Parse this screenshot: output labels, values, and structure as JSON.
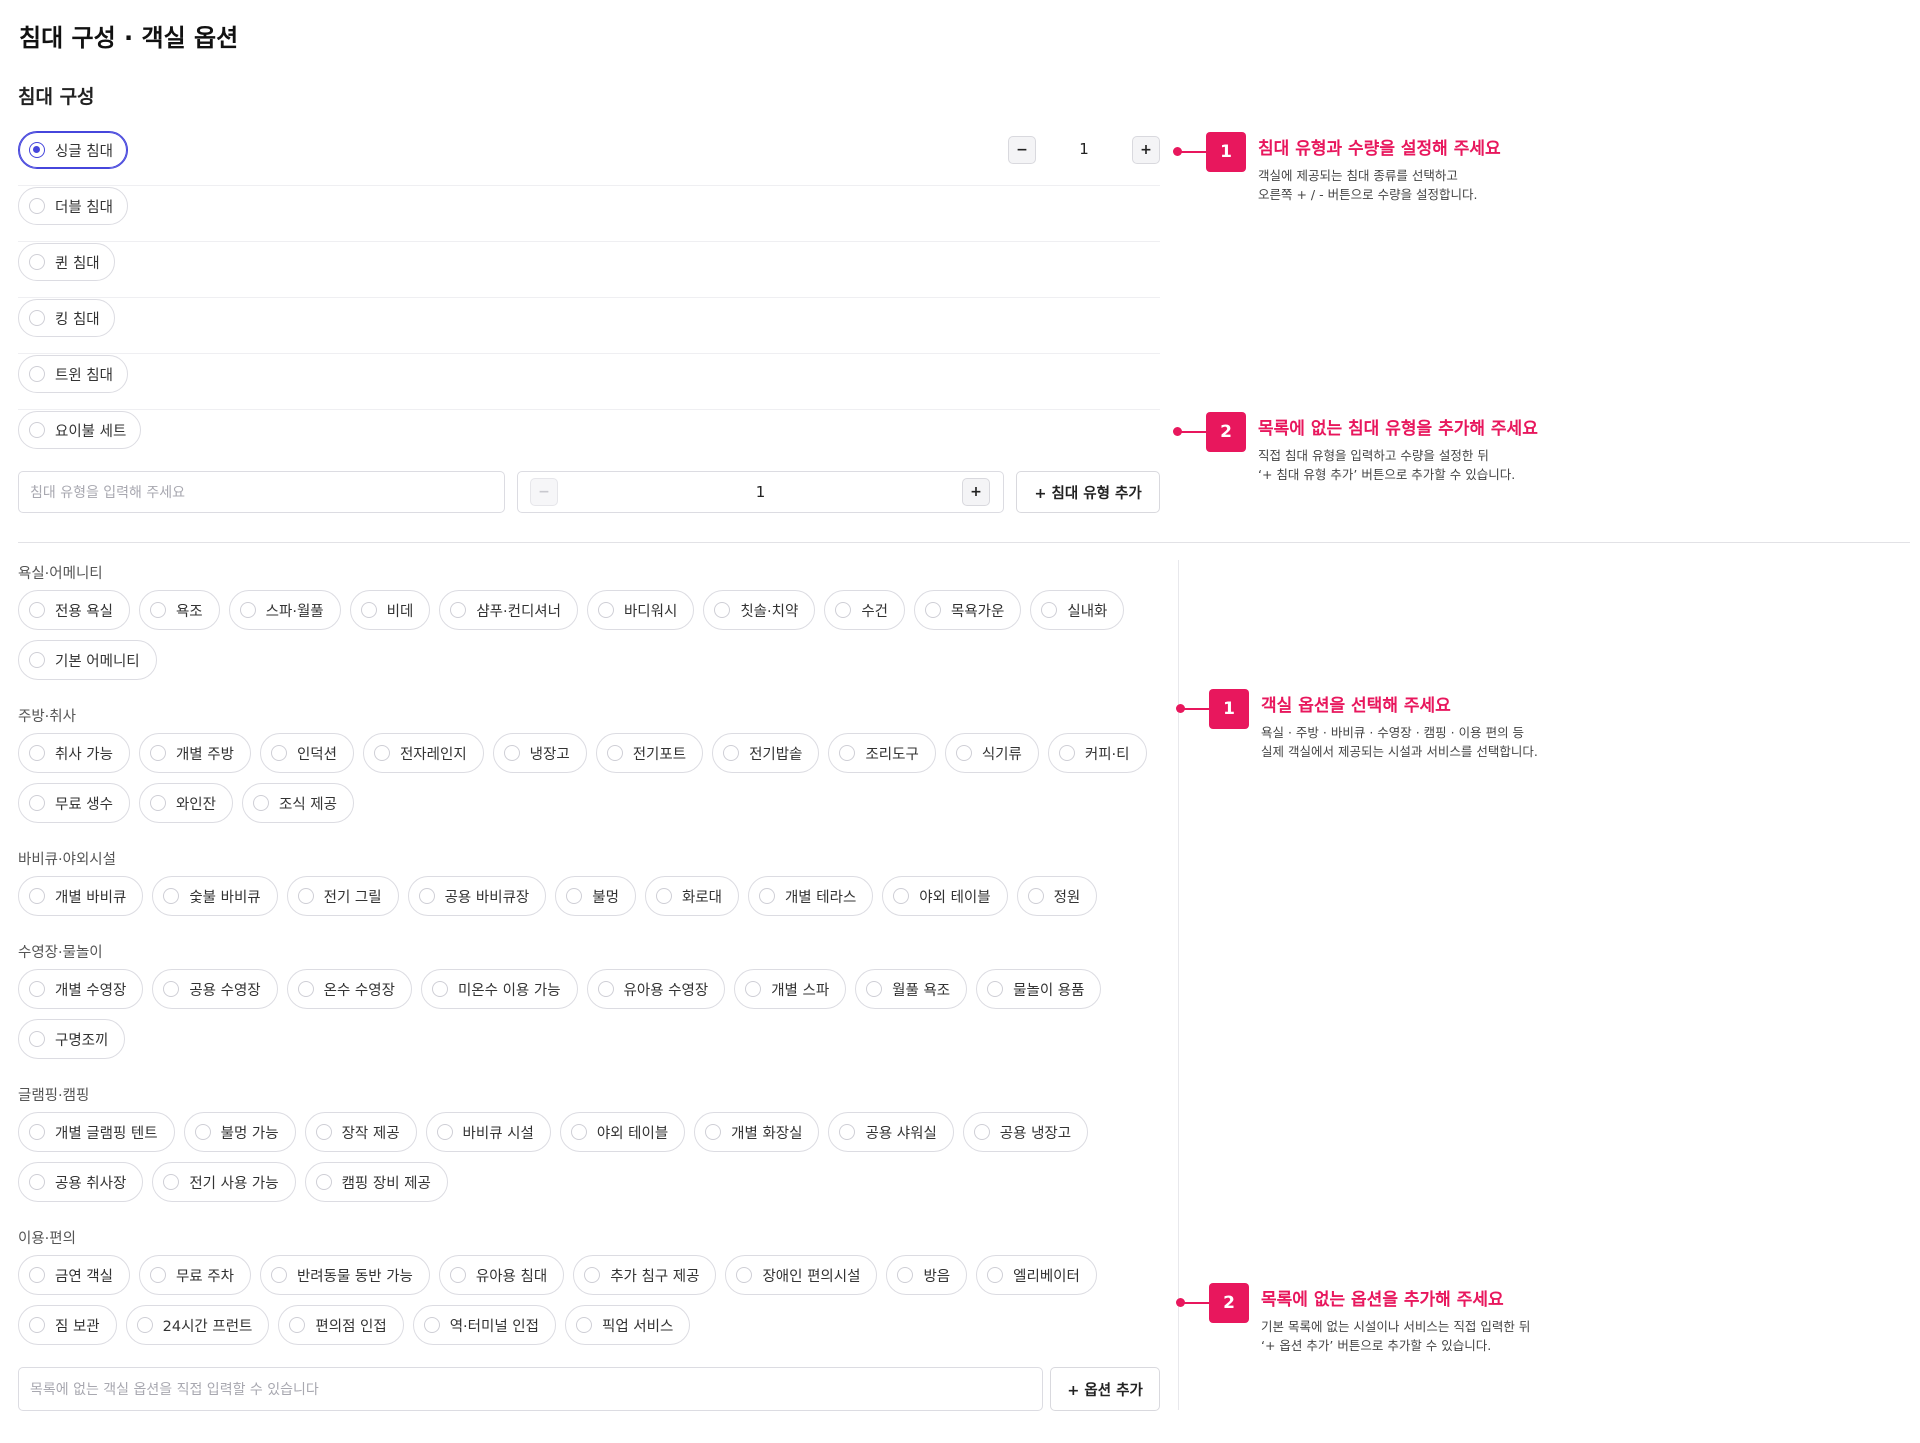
{
  "page_title": "침대 구성 · 객실 옵션",
  "bed_section": {
    "title": "침대 구성",
    "beds": [
      {
        "label": "싱글 침대",
        "selected": true
      },
      {
        "label": "더블 침대",
        "selected": false
      },
      {
        "label": "퀸 침대",
        "selected": false
      },
      {
        "label": "킹 침대",
        "selected": false
      },
      {
        "label": "트윈 침대",
        "selected": false
      },
      {
        "label": "요이불 세트",
        "selected": false
      }
    ],
    "stepper": {
      "minus": "−",
      "value": "1",
      "plus": "+"
    },
    "custom": {
      "placeholder": "침대 유형을 입력해 주세요",
      "stepper_minus": "−",
      "stepper_value": "1",
      "stepper_plus": "+",
      "add_button": "+ 침대 유형 추가"
    }
  },
  "option_groups": [
    {
      "label": "욕실·어메니티",
      "options": [
        "전용 욕실",
        "욕조",
        "스파·월풀",
        "비데",
        "샴푸·컨디셔너",
        "바디워시",
        "칫솔·치약",
        "수건",
        "목욕가운",
        "실내화",
        "기본 어메니티"
      ]
    },
    {
      "label": "주방·취사",
      "options": [
        "취사 가능",
        "개별 주방",
        "인덕션",
        "전자레인지",
        "냉장고",
        "전기포트",
        "전기밥솥",
        "조리도구",
        "식기류",
        "커피·티",
        "무료 생수",
        "와인잔",
        "조식 제공"
      ]
    },
    {
      "label": "바비큐·야외시설",
      "options": [
        "개별 바비큐",
        "숯불 바비큐",
        "전기 그릴",
        "공용 바비큐장",
        "불멍",
        "화로대",
        "개별 테라스",
        "야외 테이블",
        "정원"
      ]
    },
    {
      "label": "수영장·물놀이",
      "options": [
        "개별 수영장",
        "공용 수영장",
        "온수 수영장",
        "미온수 이용 가능",
        "유아용 수영장",
        "개별 스파",
        "월풀 욕조",
        "물놀이 용품",
        "구명조끼"
      ]
    },
    {
      "label": "글램핑·캠핑",
      "options": [
        "개별 글램핑 텐트",
        "불멍 가능",
        "장작 제공",
        "바비큐 시설",
        "야외 테이블",
        "개별 화장실",
        "공용 샤워실",
        "공용 냉장고",
        "공용 취사장",
        "전기 사용 가능",
        "캠핑 장비 제공"
      ]
    },
    {
      "label": "이용·편의",
      "options": [
        "금연 객실",
        "무료 주차",
        "반려동물 동반 가능",
        "유아용 침대",
        "추가 침구 제공",
        "장애인 편의시설",
        "방음",
        "엘리베이터",
        "짐 보관",
        "24시간 프런트",
        "편의점 인접",
        "역·터미널 인접",
        "픽업 서비스"
      ]
    }
  ],
  "option_custom": {
    "placeholder": "목록에 없는 객실 옵션을 직접 입력할 수 있습니다",
    "add_button": "+ 옵션 추가"
  },
  "callouts": {
    "bed_1": {
      "num": "1",
      "title": "침대 유형과 수량을 설정해 주세요",
      "line1": "객실에 제공되는 침대 종류를 선택하고",
      "line2": "오른쪽 + / - 버튼으로 수량을 설정합니다."
    },
    "bed_2": {
      "num": "2",
      "title": "목록에 없는 침대 유형을 추가해 주세요",
      "line1": "직접 침대 유형을 입력하고 수량을 설정한 뒤",
      "line2": "‘+ 침대 유형 추가’ 버튼으로 추가할 수 있습니다."
    },
    "opt_1": {
      "num": "1",
      "title": "객실 옵션을 선택해 주세요",
      "line1": "욕실 · 주방 · 바비큐 · 수영장 · 캠핑 · 이용 편의 등",
      "line2": "실제 객실에서 제공되는 시설과 서비스를 선택합니다."
    },
    "opt_2": {
      "num": "2",
      "title": "목록에 없는 옵션을 추가해 주세요",
      "line1": "기본 목록에 없는 시설이나 서비스는 직접 입력한 뒤",
      "line2": "‘+ 옵션 추가’ 버튼으로 추가할 수 있습니다."
    }
  },
  "colors": {
    "accent": "#e8175d",
    "selected": "#4646dc",
    "border": "#dcdce2"
  }
}
